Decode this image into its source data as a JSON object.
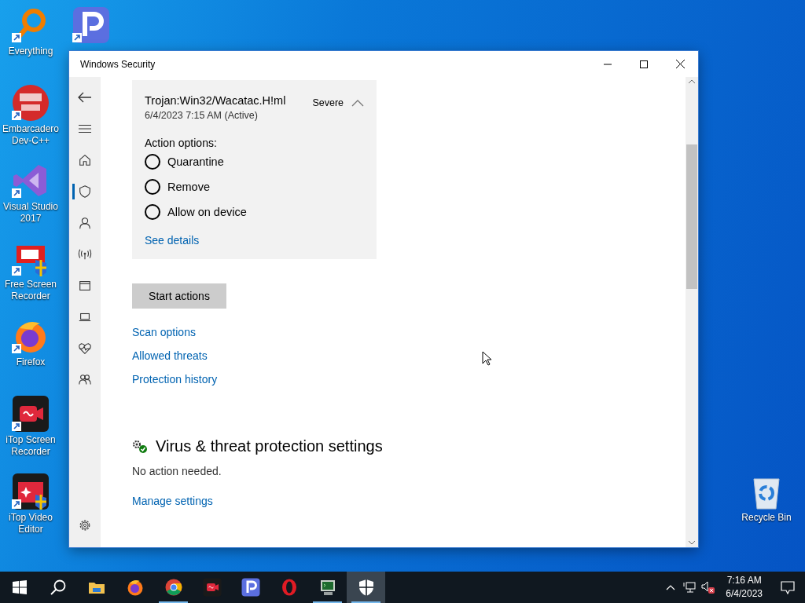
{
  "desktop_icons": [
    {
      "kind": "everything",
      "label": "Everything"
    },
    {
      "kind": "devcpp",
      "label": "Embarcadero Dev-C++"
    },
    {
      "kind": "vs",
      "label": "Visual Studio 2017"
    },
    {
      "kind": "rec",
      "label": "Free Screen Recorder"
    },
    {
      "kind": "firefox",
      "label": "Firefox"
    },
    {
      "kind": "itoprec",
      "label": "iTop Screen Recorder"
    },
    {
      "kind": "itopvideo",
      "label": "iTop Video Editor"
    }
  ],
  "partial_icon": {
    "kind": "pdf"
  },
  "recycle_bin": {
    "kind": "recycle",
    "label": "Recycle Bin"
  },
  "window": {
    "title": "Windows Security",
    "nav": [
      {
        "kind": "home",
        "selected": false
      },
      {
        "kind": "shield",
        "selected": true
      },
      {
        "kind": "person",
        "selected": false
      },
      {
        "kind": "wireless",
        "selected": false
      },
      {
        "kind": "browser",
        "selected": false
      },
      {
        "kind": "laptop",
        "selected": false
      },
      {
        "kind": "heart",
        "selected": false
      },
      {
        "kind": "family",
        "selected": false
      }
    ],
    "threat": {
      "name": "Trojan:Win32/Wacatac.H!ml",
      "date": "6/4/2023 7:15 AM (Active)",
      "severity": "Severe",
      "expanded": true,
      "action_label": "Action options:",
      "options": [
        {
          "label": "Quarantine",
          "selected": false
        },
        {
          "label": "Remove",
          "selected": false
        },
        {
          "label": "Allow on device",
          "selected": false
        }
      ],
      "details_link": "See details"
    },
    "start_button": "Start actions",
    "links": [
      "Scan options",
      "Allowed threats",
      "Protection history"
    ],
    "settings": {
      "heading": "Virus & threat protection settings",
      "status": "No action needed.",
      "link": "Manage settings"
    }
  },
  "taskbar": {
    "apps": [
      {
        "kind": "explorer",
        "running": false,
        "active": false
      },
      {
        "kind": "firefox",
        "running": false,
        "active": false
      },
      {
        "kind": "chrome",
        "running": true,
        "active": false
      },
      {
        "kind": "itoprec",
        "running": false,
        "active": false
      },
      {
        "kind": "pdf",
        "running": false,
        "active": false
      },
      {
        "kind": "opera",
        "running": false,
        "active": false
      },
      {
        "kind": "terminal",
        "running": true,
        "active": false
      },
      {
        "kind": "shield",
        "running": true,
        "active": true
      }
    ],
    "time": "7:16 AM",
    "date": "6/4/2023"
  }
}
